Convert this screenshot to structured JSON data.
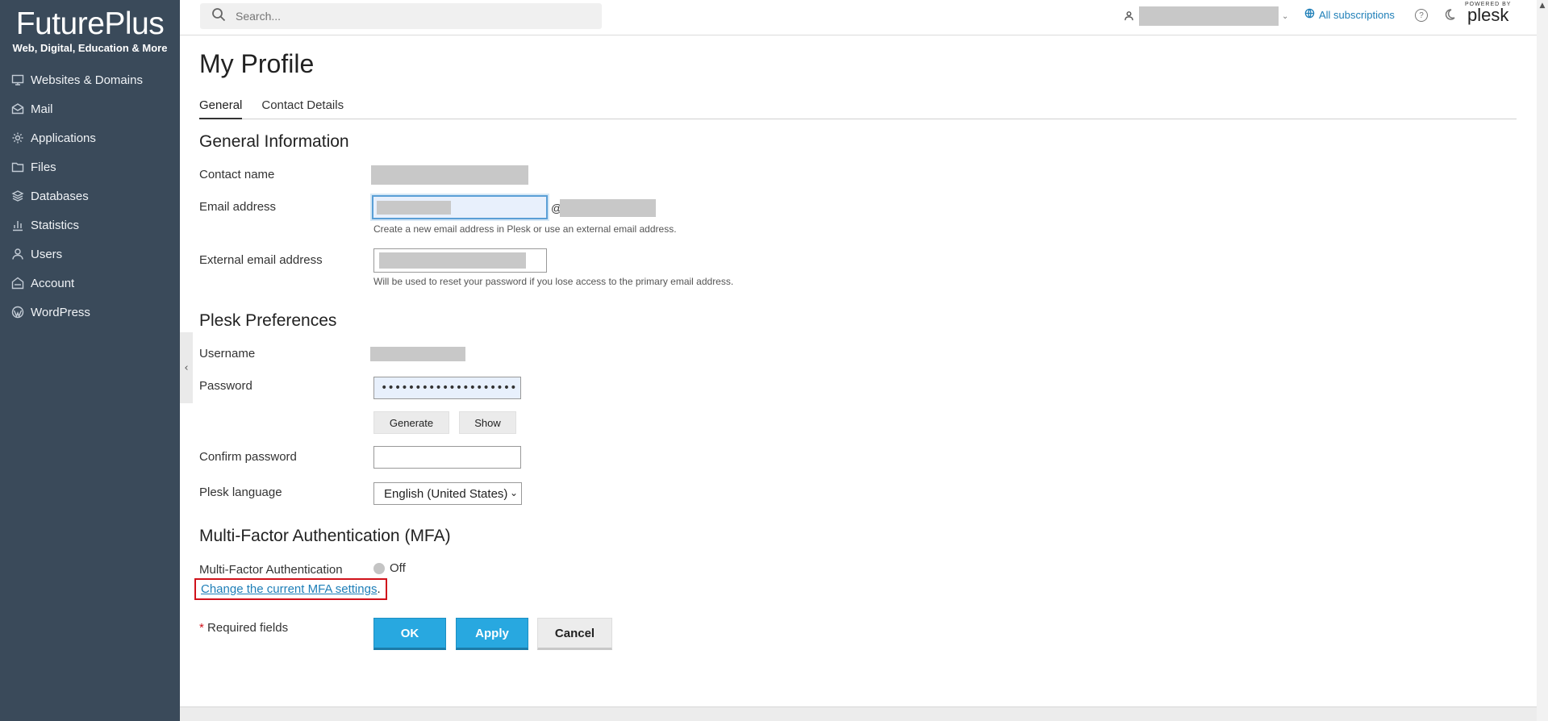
{
  "brand": {
    "name": "FuturePlus",
    "tagline": "Web, Digital, Education & More"
  },
  "nav": [
    {
      "label": "Websites & Domains",
      "icon": "monitor-icon"
    },
    {
      "label": "Mail",
      "icon": "mail-icon"
    },
    {
      "label": "Applications",
      "icon": "gear-icon"
    },
    {
      "label": "Files",
      "icon": "folder-icon"
    },
    {
      "label": "Databases",
      "icon": "database-icon"
    },
    {
      "label": "Statistics",
      "icon": "bar-chart-icon"
    },
    {
      "label": "Users",
      "icon": "user-icon"
    },
    {
      "label": "Account",
      "icon": "account-icon"
    },
    {
      "label": "WordPress",
      "icon": "wordpress-icon"
    }
  ],
  "header": {
    "search_placeholder": "Search...",
    "subscriptions": "All subscriptions",
    "help": "?",
    "powered_by": "POWERED BY",
    "plesk": "plesk"
  },
  "page": {
    "title": "My Profile",
    "tabs": [
      "General",
      "Contact Details"
    ]
  },
  "general": {
    "title": "General Information",
    "contact_name_label": "Contact name",
    "email_label": "Email address",
    "at_sign": "@",
    "email_hint": "Create a new email address in Plesk or use an external email address.",
    "external_email_label": "External email address",
    "external_email_hint": "Will be used to reset your password if you lose access to the primary email address."
  },
  "prefs": {
    "title": "Plesk Preferences",
    "username_label": "Username",
    "password_label": "Password",
    "password_value": "••••••••••••••••••••",
    "generate": "Generate",
    "show": "Show",
    "confirm_label": "Confirm password",
    "language_label": "Plesk language",
    "language_value": "English (United States)"
  },
  "mfa": {
    "title": "Multi-Factor Authentication (MFA)",
    "label": "Multi-Factor Authentication",
    "status": "Off",
    "link": "Change the current MFA settings",
    "link_suffix": "."
  },
  "form": {
    "required_star": "*",
    "required_text": "Required fields",
    "ok": "OK",
    "apply": "Apply",
    "cancel": "Cancel"
  }
}
